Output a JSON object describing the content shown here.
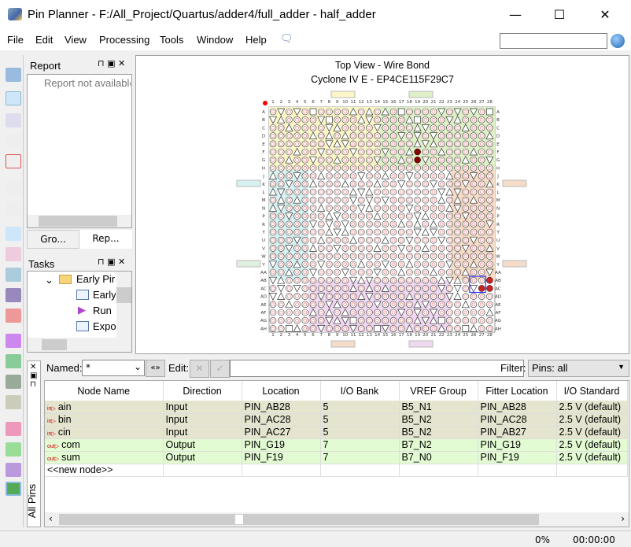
{
  "window": {
    "title": "Pin Planner - F:/All_Project/Quartus/adder4/full_adder - half_adder",
    "minimize": "—",
    "maximize": "☐",
    "close": "✕"
  },
  "menu": [
    "File",
    "Edit",
    "View",
    "Processing",
    "Tools",
    "Window",
    "Help"
  ],
  "report": {
    "title": "Report",
    "empty": "Report not available",
    "tabs": [
      "Gro...",
      "Rep..."
    ]
  },
  "tasks": {
    "title": "Tasks",
    "items": [
      "Early Pin Planning",
      "Early Pin Planning",
      "Run I/O Assignment Analysis",
      "Export Pin Assignments"
    ],
    "visible": [
      "Early Pir",
      "Early",
      "Run",
      "Expo"
    ]
  },
  "package": {
    "title": "Top View - Wire Bond",
    "device": "Cyclone IV E - EP4CE115F29C7",
    "rows": [
      "A",
      "B",
      "C",
      "D",
      "E",
      "F",
      "G",
      "H",
      "J",
      "K",
      "L",
      "M",
      "N",
      "P",
      "R",
      "T",
      "U",
      "V",
      "W",
      "Y",
      "AA",
      "AB",
      "AC",
      "AD",
      "AE",
      "AF",
      "AG",
      "AH"
    ],
    "assigned_pins": [
      {
        "pin": "AB28",
        "dir": "in"
      },
      {
        "pin": "AC28",
        "dir": "in"
      },
      {
        "pin": "AC27",
        "dir": "in"
      },
      {
        "pin": "G19",
        "dir": "out"
      },
      {
        "pin": "F19",
        "dir": "out"
      }
    ],
    "colors": {
      "assigned": "#8b0000",
      "bank_top_left": "#fbf6c8",
      "bank_top_right": "#dff0c8",
      "bank_left": "#d8f0f0",
      "bank_right": "#f5dcc8",
      "bank_bottom": "#f0d8f0"
    }
  },
  "pins_panel": {
    "vertical_tab": "All Pins",
    "named_label": "Named:",
    "named_value": "*",
    "edit_label": "Edit:",
    "filter_label": "Filter:",
    "filter_value": "Pins: all",
    "columns": [
      "Node Name",
      "Direction",
      "Location",
      "I/O Bank",
      "VREF Group",
      "Fitter Location",
      "I/O Standard"
    ],
    "rows": [
      {
        "type": "in",
        "name": "ain",
        "cells": [
          "Input",
          "PIN_AB28",
          "5",
          "B5_N1",
          "PIN_AB28",
          "2.5 V (default)"
        ]
      },
      {
        "type": "in",
        "name": "bin",
        "cells": [
          "Input",
          "PIN_AC28",
          "5",
          "B5_N2",
          "PIN_AC28",
          "2.5 V (default)"
        ]
      },
      {
        "type": "in",
        "name": "cin",
        "cells": [
          "Input",
          "PIN_AC27",
          "5",
          "B5_N2",
          "PIN_AB27",
          "2.5 V (default)"
        ]
      },
      {
        "type": "out",
        "name": "com",
        "cells": [
          "Output",
          "PIN_G19",
          "7",
          "B7_N2",
          "PIN_G19",
          "2.5 V (default)"
        ]
      },
      {
        "type": "out",
        "name": "sum",
        "cells": [
          "Output",
          "PIN_F19",
          "7",
          "B7_N0",
          "PIN_F19",
          "2.5 V (default)"
        ]
      }
    ],
    "new_node": "<<new node>>"
  },
  "status": {
    "progress": "0%",
    "time": "00:00:00"
  }
}
